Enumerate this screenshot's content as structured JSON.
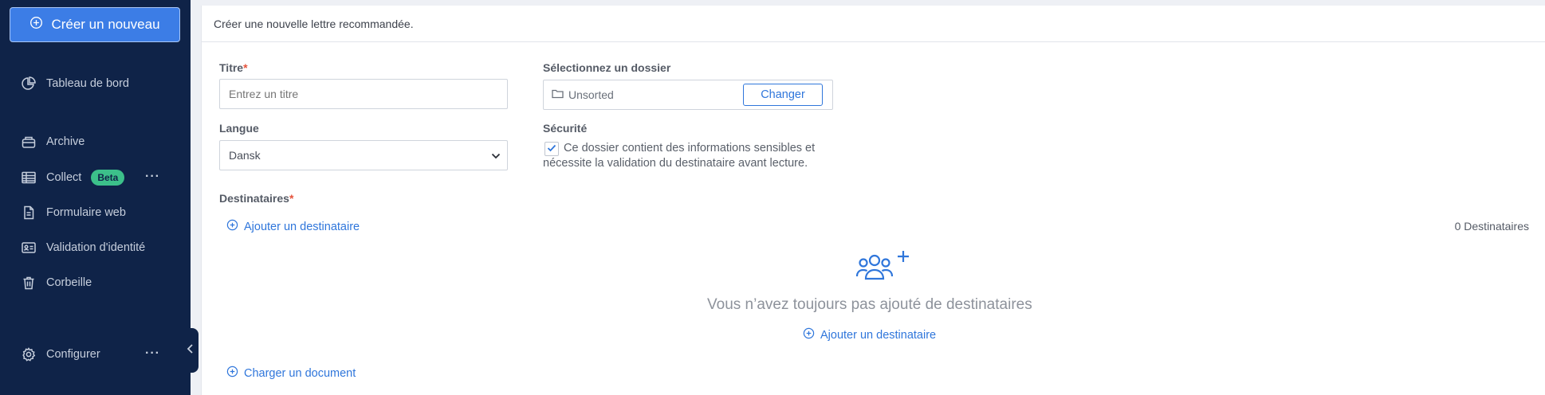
{
  "sidebar": {
    "create_label": "Créer un nouveau",
    "items": [
      {
        "label": "Tableau de bord",
        "icon": "chart-pie-icon"
      },
      {
        "label": "Archive",
        "icon": "archive-box-icon"
      },
      {
        "label": "Collect",
        "icon": "table-icon",
        "badge": "Beta"
      },
      {
        "label": "Formulaire web",
        "icon": "document-icon"
      },
      {
        "label": "Validation d'identité",
        "icon": "id-card-icon"
      },
      {
        "label": "Corbeille",
        "icon": "trash-icon"
      },
      {
        "label": "Configurer",
        "icon": "gear-icon"
      }
    ]
  },
  "header": {
    "title": "Créer une nouvelle lettre recommandée."
  },
  "form": {
    "title_label": "Titre",
    "title_placeholder": "Entrez un titre",
    "folder_label": "Sélectionnez un dossier",
    "folder_value": "Unsorted",
    "change_label": "Changer",
    "language_label": "Langue",
    "language_value": "Dansk",
    "security_label": "Sécurité",
    "security_checked": true,
    "security_line1": "Ce dossier contient des informations sensibles et",
    "security_line2": "nécessite la validation du destinataire avant lecture.",
    "recipients_label": "Destinataires",
    "add_recipient_label": "Ajouter un destinataire",
    "recipients_count": "0 Destinataires",
    "empty_message": "Vous n’avez toujours pas ajouté de destinataires",
    "empty_add_label": "Ajouter un destinataire",
    "upload_label": "Charger un document"
  },
  "colors": {
    "sidebar_bg": "#0f2348",
    "accent": "#2f76db",
    "badge": "#3cc08a",
    "required": "#e5533c"
  }
}
